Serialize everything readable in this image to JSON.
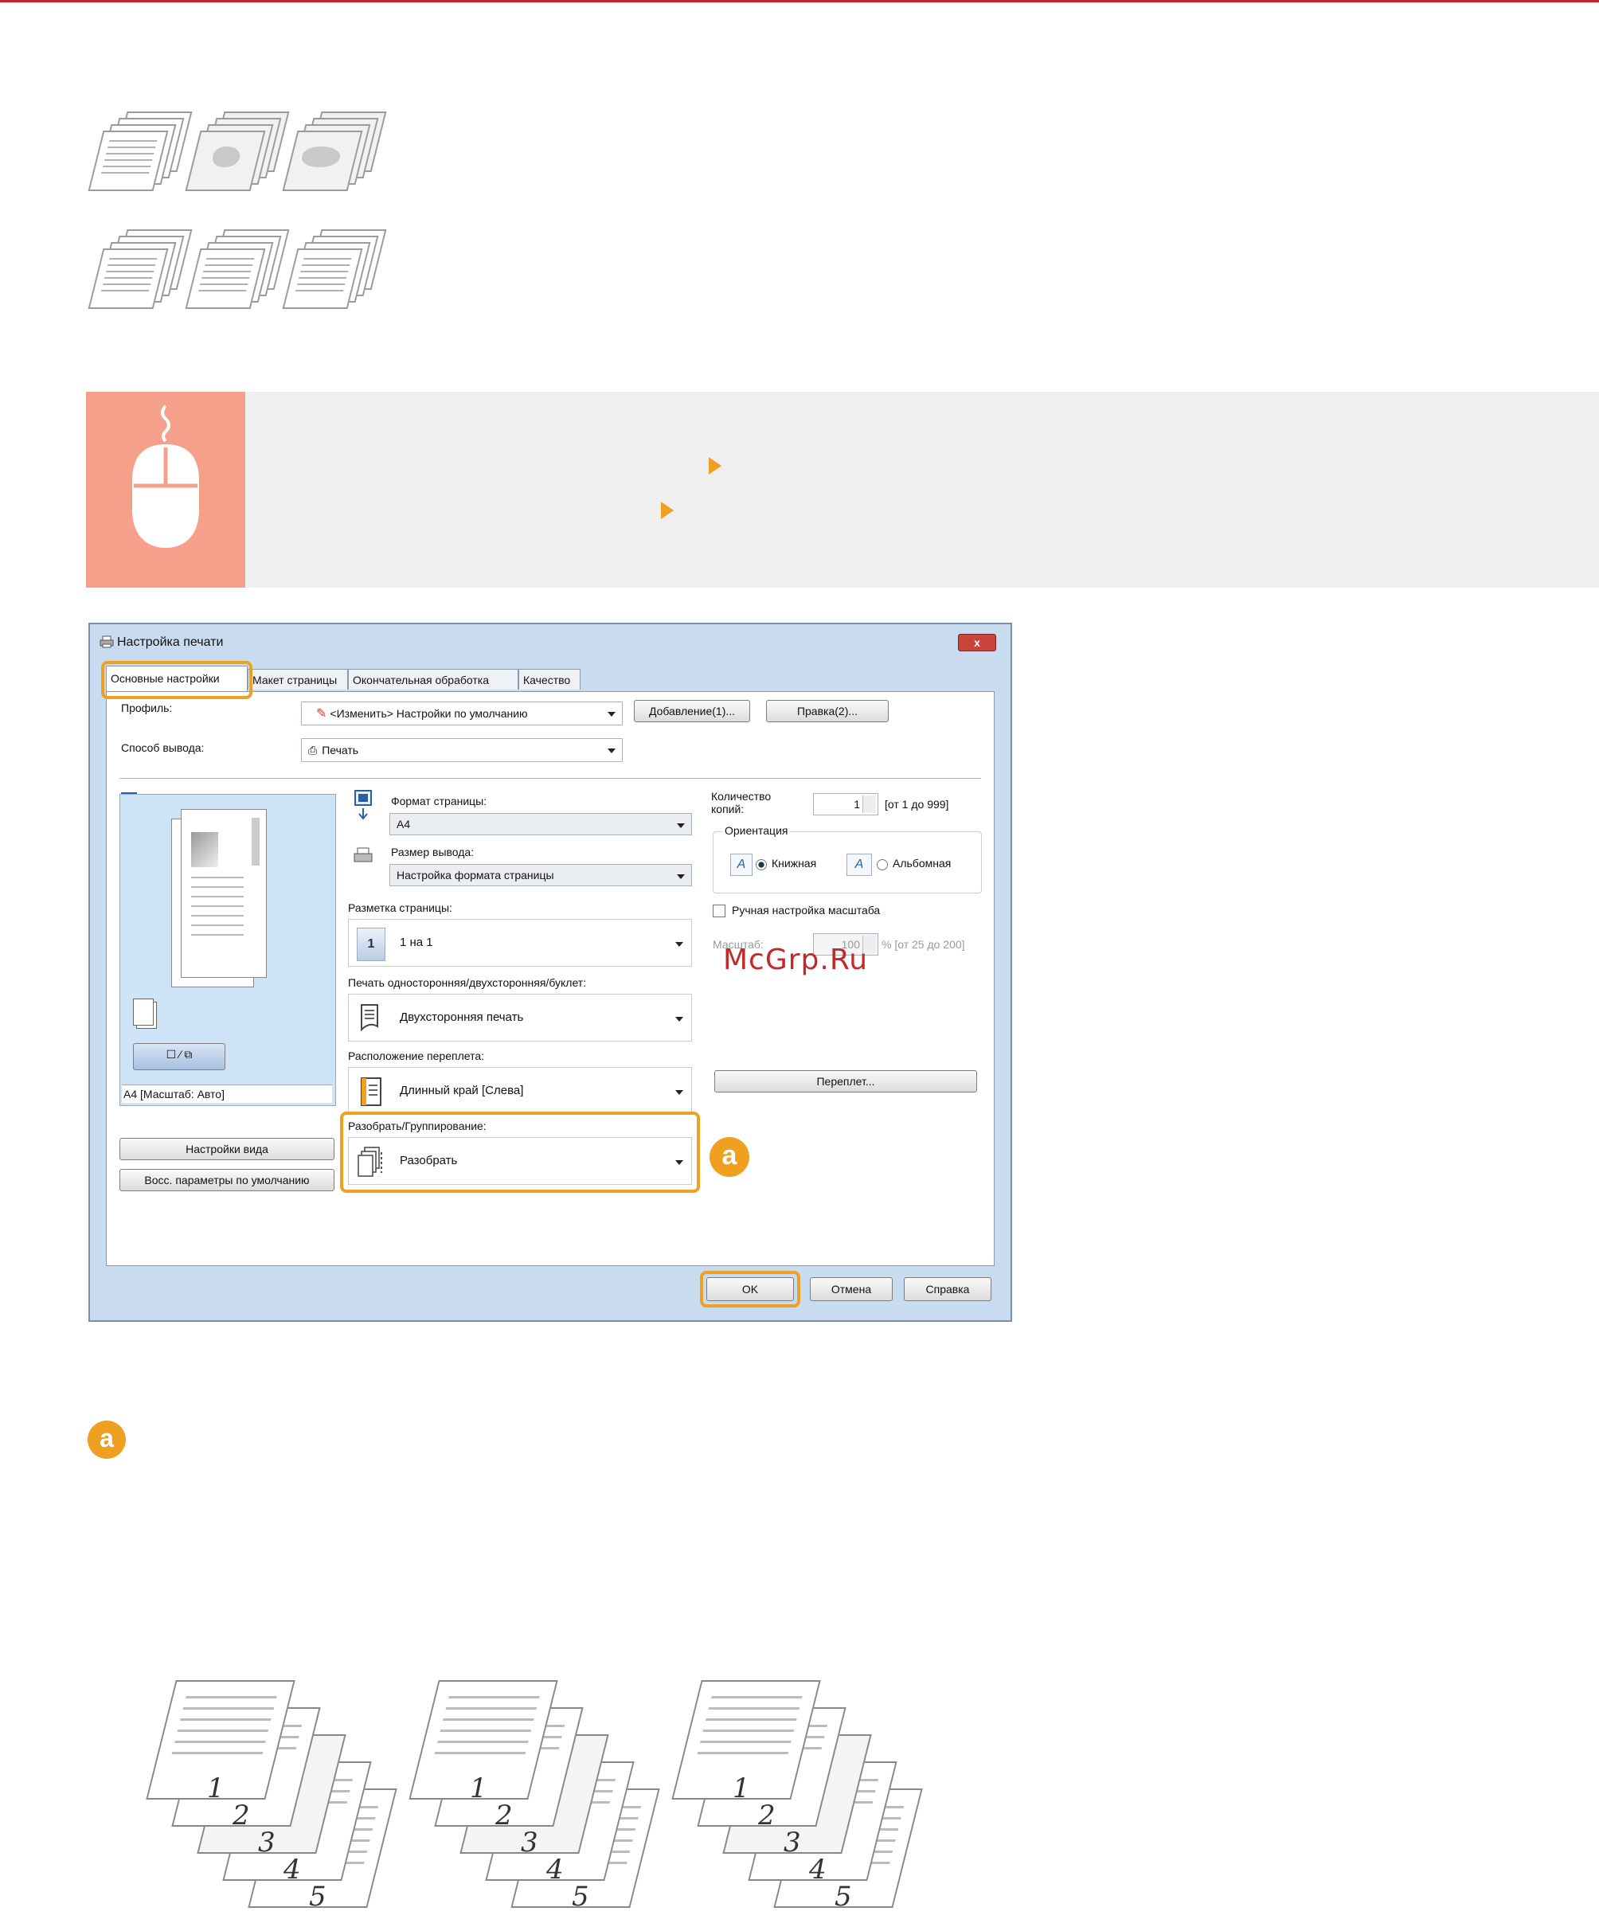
{
  "dialog": {
    "title": "Настройка печати",
    "close_label": "x",
    "tabs": [
      "Основные настройки",
      "Макет страницы",
      "Окончательная обработка",
      "Качество"
    ],
    "profile_label": "Профиль:",
    "profile_value": "<Изменить> Настройки по умолчанию",
    "add_button": "Добавление(1)...",
    "edit_button": "Правка(2)...",
    "output_label": "Способ вывода:",
    "output_value": "Печать",
    "preview_caption": "A4 [Масштаб: Авто]",
    "page_size_label": "Формат страницы:",
    "page_size_value": "A4",
    "output_size_label": "Размер вывода:",
    "output_size_value": "Настройка формата страницы",
    "layout_label": "Разметка страницы:",
    "layout_value": "1 на 1",
    "duplex_label": "Печать односторонняя/двухсторонняя/буклет:",
    "duplex_value": "Двухсторонняя печать",
    "binding_label": "Расположение переплета:",
    "binding_value": "Длинный край [Слева]",
    "collate_label": "Разобрать/Группирование:",
    "collate_value": "Разобрать",
    "copies_label": "Количество копий:",
    "copies_value": "1",
    "copies_range": "[от 1 до 999]",
    "orientation_label": "Ориентация",
    "portrait_label": "Книжная",
    "landscape_label": "Альбомная",
    "manual_scale_label": "Ручная настройка масштаба",
    "scale_label": "Масштаб:",
    "scale_value": "100",
    "scale_range": "% [от 25 до 200]",
    "binding_button": "Переплет...",
    "view_settings_button": "Настройки вида",
    "restore_defaults_button": "Восс. параметры по умолчанию",
    "ok_button": "OK",
    "cancel_button": "Отмена",
    "help_button": "Справка"
  },
  "callout_badge": "a",
  "legend_badge": "a",
  "watermark": "McGrp.Ru",
  "page_numbers": [
    "1",
    "2",
    "3",
    "4",
    "5"
  ],
  "colors": {
    "accent": "#f0a020",
    "banner_side": "#f4a08a",
    "top_rule": "#c4282a",
    "watermark": "#c22a2a"
  }
}
